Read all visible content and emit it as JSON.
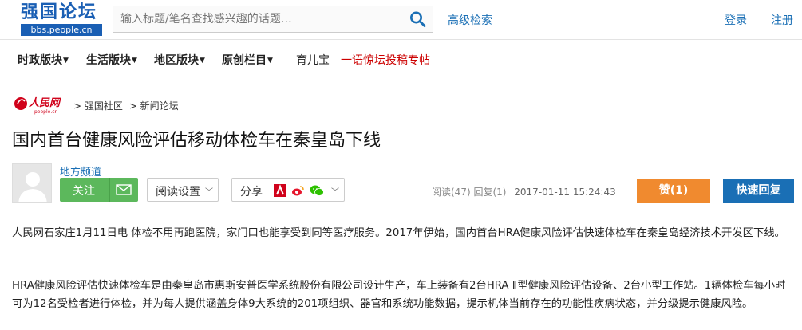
{
  "header": {
    "logo_text": "强国论坛",
    "logo_domain": "bbs.people.cn",
    "search_placeholder": "输入标题/笔名查找感兴趣的话题…",
    "advanced_search": "高级检索",
    "login": "登录",
    "register": "注册",
    "brand_color": "#1a5fb4"
  },
  "nav": {
    "items": [
      {
        "label": "时政版块"
      },
      {
        "label": "生活版块"
      },
      {
        "label": "地区版块"
      },
      {
        "label": "原创栏目"
      }
    ],
    "plain_link": "育儿宝",
    "highlight_link": "一语惊坛投稿专帖"
  },
  "breadcrumb": {
    "logo_text": "人民网",
    "logo_sub": "people.cn",
    "items": [
      "> 强国社区",
      "> 新闻论坛"
    ]
  },
  "post": {
    "title": "国内首台健康风险评估移动体检车在秦皇岛下线",
    "author_channel": "地方频道",
    "follow_label": "关注",
    "reading_settings": "阅读设置",
    "share_label": "分享",
    "stats": "阅读(47) 回复(1)",
    "timestamp": "2017-01-11 15:24:43",
    "like_label": "赞(1)",
    "quick_reply": "快速回复",
    "like_color": "#f08a2f",
    "follow_color": "#5cb85c"
  },
  "content": {
    "paragraphs": [
      "人民网石家庄1月11日电 体检不用再跑医院，家门口也能享受到同等医疗服务。2017年伊始，国内首台HRA健康风险评估快速体检车在秦皇岛经济技术开发区下线。",
      "HRA健康风险评估快速体检车是由秦皇岛市惠斯安普医学系统股份有限公司设计生产，车上装备有2台HRA Ⅱ型健康风险评估设备、2台小型工作站。1辆体检车每小时可为12名受检者进行体检，并为每人提供涵盖身体9大系统的201项组织、器官和系统功能数据，提示机体当前存在的功能性疾病状态，并分级提示健康风险。"
    ]
  }
}
